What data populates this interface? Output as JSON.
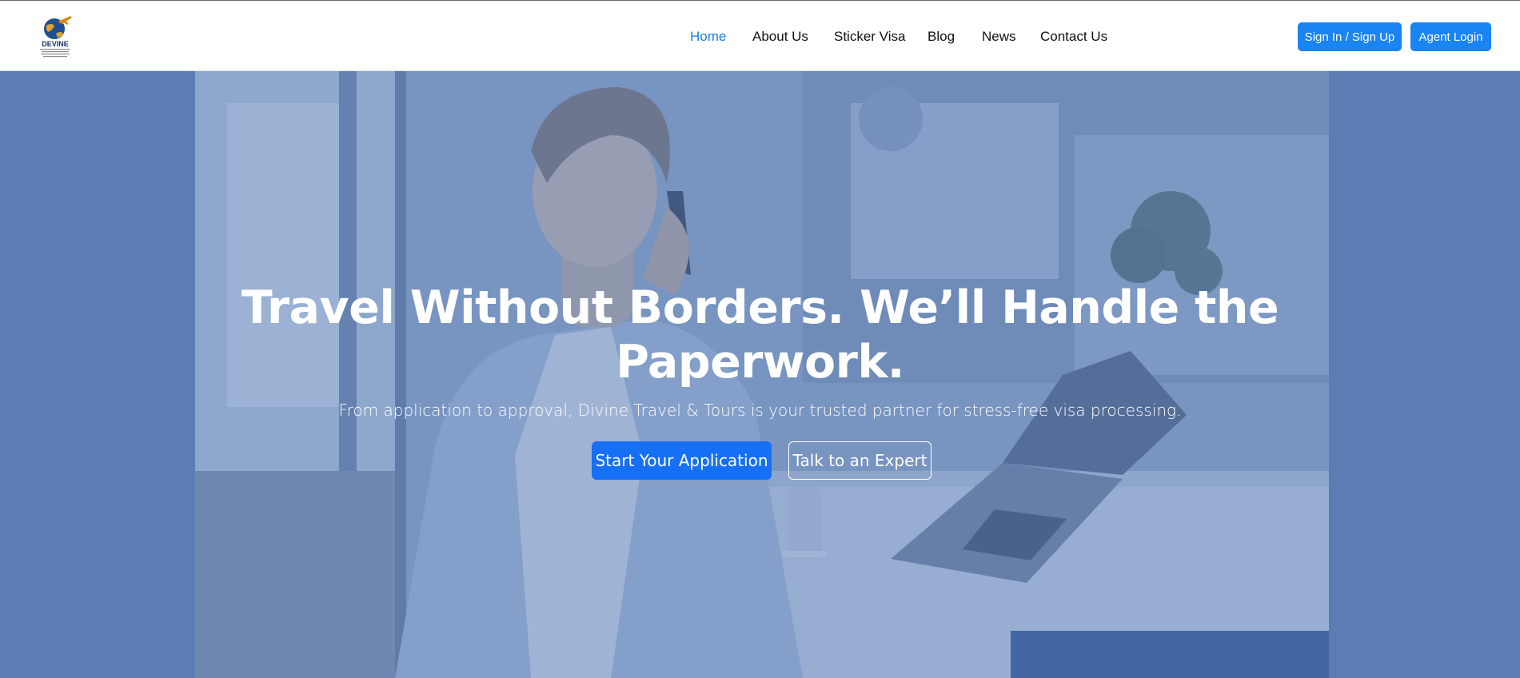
{
  "brand": {
    "logo_text": "DEVINE",
    "logo_icon": "globe-airplane-logo"
  },
  "nav": {
    "items": [
      {
        "label": "Home",
        "active": true
      },
      {
        "label": "About Us",
        "active": false
      },
      {
        "label": "Sticker Visa",
        "active": false
      },
      {
        "label": "Blog",
        "active": false
      },
      {
        "label": "News",
        "active": false
      },
      {
        "label": "Contact Us",
        "active": false
      }
    ],
    "signin_label": "Sign In / Sign Up",
    "agent_label": "Agent Login"
  },
  "hero": {
    "title_line1": "Travel Without Borders. We’ll Handle the",
    "title_line2": "Paperwork.",
    "subtitle": "From application to approval, Divine Travel & Tours is your trusted partner for stress-free visa processing.",
    "primary_cta": "Start Your Application",
    "secondary_cta": "Talk to an Expert",
    "image": "man-on-phone-at-cafe-with-laptop"
  },
  "colors": {
    "accent": "#1a84f2",
    "active_link": "#1a7fe0",
    "hero_overlay": "#6b87b5",
    "primary_button": "#1670f5"
  }
}
